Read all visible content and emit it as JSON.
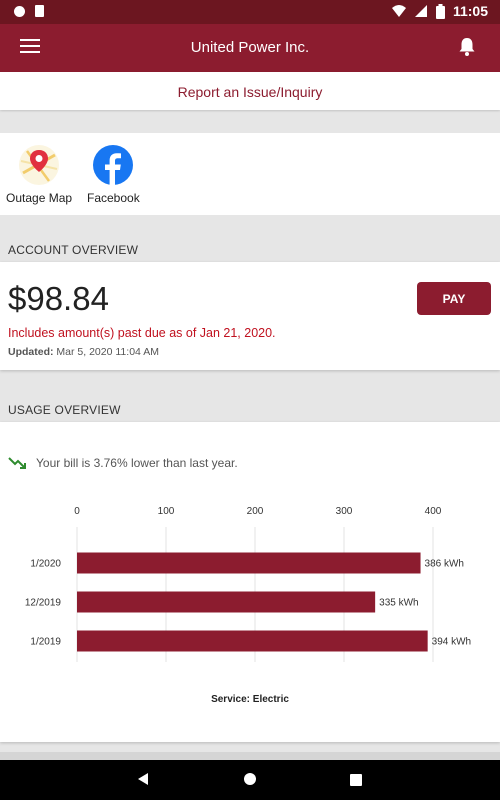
{
  "status_bar": {
    "time": "11:05"
  },
  "app_bar": {
    "title": "United Power Inc."
  },
  "report": {
    "label": "Report an Issue/Inquiry"
  },
  "shortcuts": [
    {
      "label": "Outage Map",
      "icon": "map-pin-icon"
    },
    {
      "label": "Facebook",
      "icon": "facebook-icon"
    }
  ],
  "account": {
    "header": "ACCOUNT OVERVIEW",
    "amount": "$98.84",
    "pay_label": "PAY",
    "past_due": "Includes amount(s) past due as of Jan 21, 2020.",
    "updated_label": "Updated:",
    "updated_value": "Mar 5, 2020 11:04 AM"
  },
  "usage": {
    "header": "USAGE OVERVIEW",
    "trend_text": "Your bill is 3.76% lower than last year.",
    "trend_icon": "trend-down-icon"
  },
  "colors": {
    "brand": "#8c1c2f",
    "status": "#6c1620",
    "error": "#c0111f",
    "trend": "#2e8b2e"
  },
  "chart_data": {
    "type": "bar",
    "orientation": "horizontal",
    "categories": [
      "1/2020",
      "12/2019",
      "1/2019"
    ],
    "values": [
      386,
      335,
      394
    ],
    "value_labels": [
      "386 kWh",
      "335 kWh",
      "394 kWh"
    ],
    "xticks": [
      "0",
      "100",
      "200",
      "300",
      "400"
    ],
    "xlim": [
      0,
      400
    ],
    "caption": "Service: Electric",
    "grid": true,
    "bar_color": "#8c1c2f"
  }
}
